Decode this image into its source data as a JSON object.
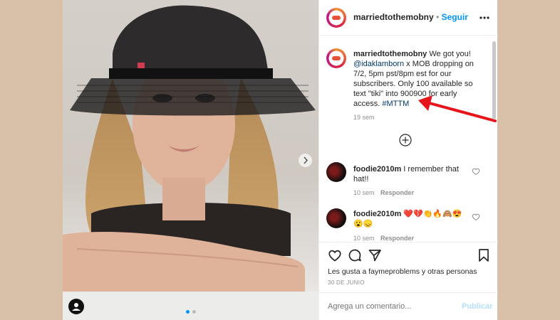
{
  "post": {
    "username": "marriedtothemobny",
    "separator": "•",
    "follow_label": "Seguir"
  },
  "caption": {
    "username": "marriedtothemobny",
    "text_1": " We got you! ",
    "mention": "@idaklamborn",
    "text_2": " x MOB dropping on 7/2, 5pm pst/8pm est for our subscribers. Only 100 available so text \"tiki\" into 900900 for early access. ",
    "hashtag": "#MTTM",
    "time": "19 sem"
  },
  "comments": [
    {
      "username": "foodie2010m",
      "text": " I remember that hat!!",
      "time": "10 sem",
      "reply_label": "Responder"
    },
    {
      "username": "foodie2010m",
      "text": " ❤️💔👏🔥🙈😍😮😞",
      "time": "10 sem",
      "reply_label": "Responder"
    }
  ],
  "likes_text": "Les gusta a faymeproblems y otras personas",
  "date": "30 DE JUNIO",
  "comment_input": {
    "placeholder": "Agrega un comentario...",
    "publish_label": "Publicar"
  },
  "colors": {
    "accent": "#0095f6",
    "annotation_arrow": "#e8141b",
    "background": "#d9c1a9"
  },
  "icons": [
    "more-icon",
    "load-more-icon",
    "heart-icon",
    "comment-icon",
    "share-icon",
    "bookmark-icon",
    "next-image-icon",
    "user-tag-icon"
  ],
  "carousel": {
    "image_count": 2,
    "current": 1
  }
}
